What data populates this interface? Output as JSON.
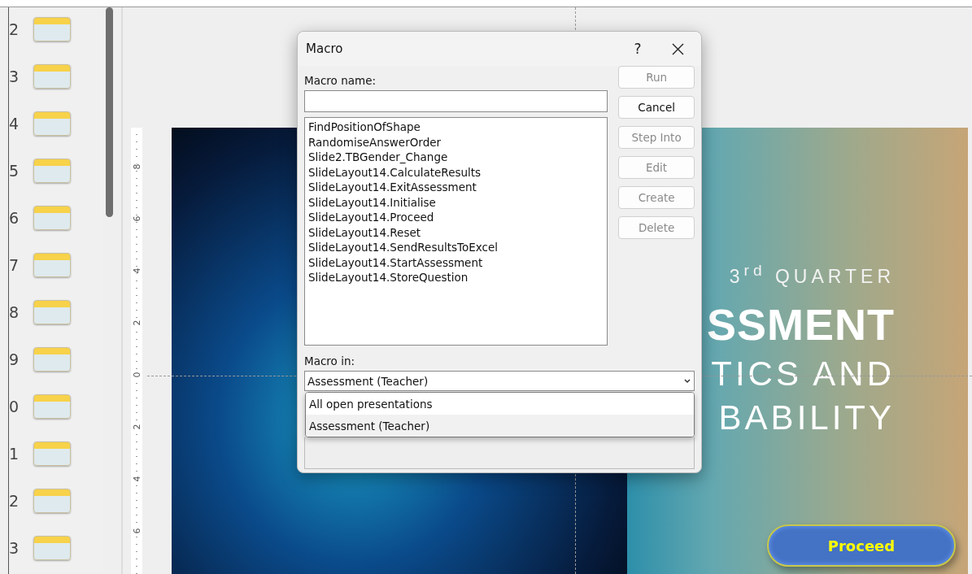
{
  "slide_panel": {
    "slides": [
      {
        "number": "2",
        "selected": false
      },
      {
        "number": "3",
        "selected": false
      },
      {
        "number": "4",
        "selected": false
      },
      {
        "number": "5",
        "selected": false
      },
      {
        "number": "6",
        "selected": false
      },
      {
        "number": "7",
        "selected": false
      },
      {
        "number": "8",
        "selected": false
      },
      {
        "number": "9",
        "selected": false
      },
      {
        "number": "0",
        "selected": false
      },
      {
        "number": "1",
        "selected": false
      },
      {
        "number": "2",
        "selected": false
      },
      {
        "number": "3",
        "selected": false
      }
    ]
  },
  "ruler": {
    "labels": [
      "8",
      "6",
      "4",
      "2",
      "0",
      "2",
      "4",
      "6"
    ]
  },
  "slide": {
    "subtitle": "3$^{rd}$ QUARTER",
    "title_lines": [
      {
        "text": "SSMENT",
        "kind": "bold"
      },
      {
        "text": "TICS AND",
        "kind": "light"
      },
      {
        "text": "BABILITY",
        "kind": "light"
      }
    ],
    "button": "Proceed"
  },
  "dialog": {
    "title": "Macro",
    "help": "?",
    "name_label": "Macro name:",
    "macros": [
      {
        "name": "FindPositionOfShape",
        "selected": false
      },
      {
        "name": "RandomiseAnswerOrder",
        "selected": false
      },
      {
        "name": "Slide2.TBGender_Change",
        "selected": false
      },
      {
        "name": "SlideLayout14.CalculateResults",
        "selected": false
      },
      {
        "name": "SlideLayout14.ExitAssessment",
        "selected": false
      },
      {
        "name": "SlideLayout14.Initialise",
        "selected": false
      },
      {
        "name": "SlideLayout14.Proceed",
        "selected": false
      },
      {
        "name": "SlideLayout14.Reset",
        "selected": false
      },
      {
        "name": "SlideLayout14.SendResultsToExcel",
        "selected": false
      },
      {
        "name": "SlideLayout14.StartAssessment",
        "selected": false
      },
      {
        "name": "SlideLayout14.StoreQuestion",
        "selected": false
      }
    ],
    "buttons": [
      {
        "label": "Run",
        "disabled": true
      },
      {
        "label": "Cancel",
        "disabled": false
      },
      {
        "label": "Step Into",
        "disabled": true
      },
      {
        "label": "Edit",
        "disabled": true
      },
      {
        "label": "Create",
        "disabled": true
      },
      {
        "label": "Delete",
        "disabled": true
      }
    ],
    "macro_in_label": "Macro in:",
    "macro_in_value": "Assessment (Teacher)",
    "macro_in_options": [
      {
        "label": "All open presentations",
        "selected": false
      },
      {
        "label": "Assessment (Teacher)",
        "selected": true
      }
    ]
  }
}
